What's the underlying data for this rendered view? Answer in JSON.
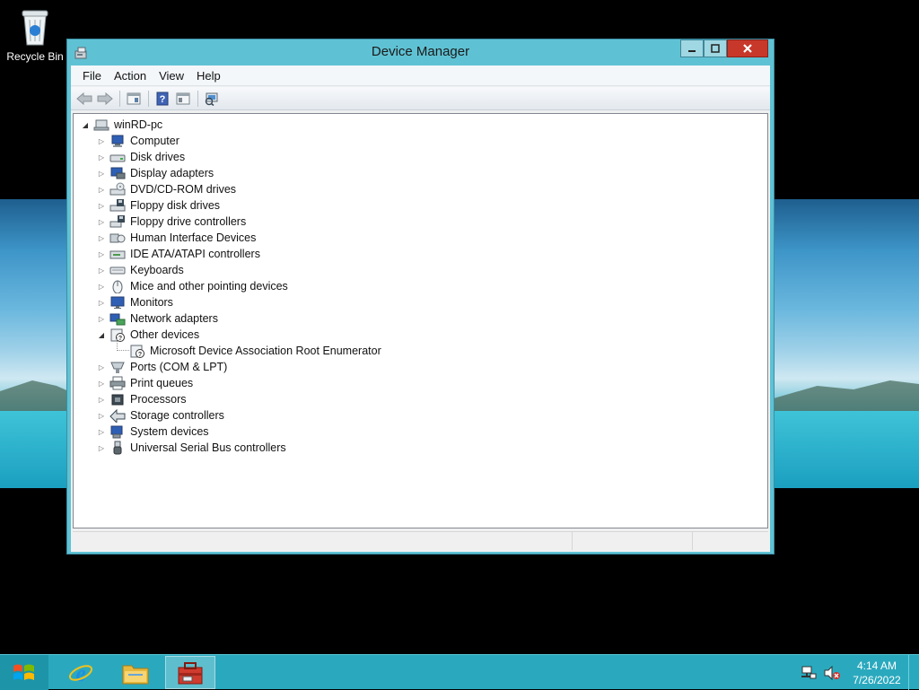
{
  "desktop": {
    "recycle_bin_label": "Recycle Bin"
  },
  "window": {
    "title": "Device Manager",
    "minimize_icon": "minimize-icon",
    "maximize_icon": "maximize-icon",
    "close_icon": "close-icon"
  },
  "menu": {
    "file": "File",
    "action": "Action",
    "view": "View",
    "help": "Help"
  },
  "toolbar": {
    "buttons": [
      "back-arrow-icon",
      "forward-arrow-icon",
      "properties-icon",
      "help-icon",
      "show-hide-icon",
      "scan-hardware-icon"
    ]
  },
  "tree": {
    "root": "winRD-pc",
    "categories": [
      {
        "label": "Computer",
        "icon": "computer-icon",
        "expanded": false
      },
      {
        "label": "Disk drives",
        "icon": "disk-drive-icon",
        "expanded": false
      },
      {
        "label": "Display adapters",
        "icon": "display-adapter-icon",
        "expanded": false
      },
      {
        "label": "DVD/CD-ROM drives",
        "icon": "dvd-drive-icon",
        "expanded": false
      },
      {
        "label": "Floppy disk drives",
        "icon": "floppy-drive-icon",
        "expanded": false
      },
      {
        "label": "Floppy drive controllers",
        "icon": "floppy-controller-icon",
        "expanded": false
      },
      {
        "label": "Human Interface Devices",
        "icon": "hid-icon",
        "expanded": false
      },
      {
        "label": "IDE ATA/ATAPI controllers",
        "icon": "ide-controller-icon",
        "expanded": false
      },
      {
        "label": "Keyboards",
        "icon": "keyboard-icon",
        "expanded": false
      },
      {
        "label": "Mice and other pointing devices",
        "icon": "mouse-icon",
        "expanded": false
      },
      {
        "label": "Monitors",
        "icon": "monitor-icon",
        "expanded": false
      },
      {
        "label": "Network adapters",
        "icon": "network-adapter-icon",
        "expanded": false
      },
      {
        "label": "Other devices",
        "icon": "unknown-device-icon",
        "expanded": true,
        "children": [
          "Microsoft Device Association Root Enumerator"
        ]
      },
      {
        "label": "Ports (COM & LPT)",
        "icon": "port-icon",
        "expanded": false
      },
      {
        "label": "Print queues",
        "icon": "printer-icon",
        "expanded": false
      },
      {
        "label": "Processors",
        "icon": "processor-icon",
        "expanded": false
      },
      {
        "label": "Storage controllers",
        "icon": "storage-controller-icon",
        "expanded": false
      },
      {
        "label": "System devices",
        "icon": "system-device-icon",
        "expanded": false
      },
      {
        "label": "Universal Serial Bus controllers",
        "icon": "usb-icon",
        "expanded": false
      }
    ]
  },
  "taskbar": {
    "pinned": [
      "internet-explorer-icon",
      "file-explorer-icon",
      "device-manager-icon"
    ],
    "active": "device-manager-icon",
    "clock_time": "4:14 AM",
    "clock_date": "7/26/2022"
  },
  "colors": {
    "window_frame": "#5fc2d4",
    "taskbar": "#2aa9be",
    "close_button": "#c7382a"
  }
}
